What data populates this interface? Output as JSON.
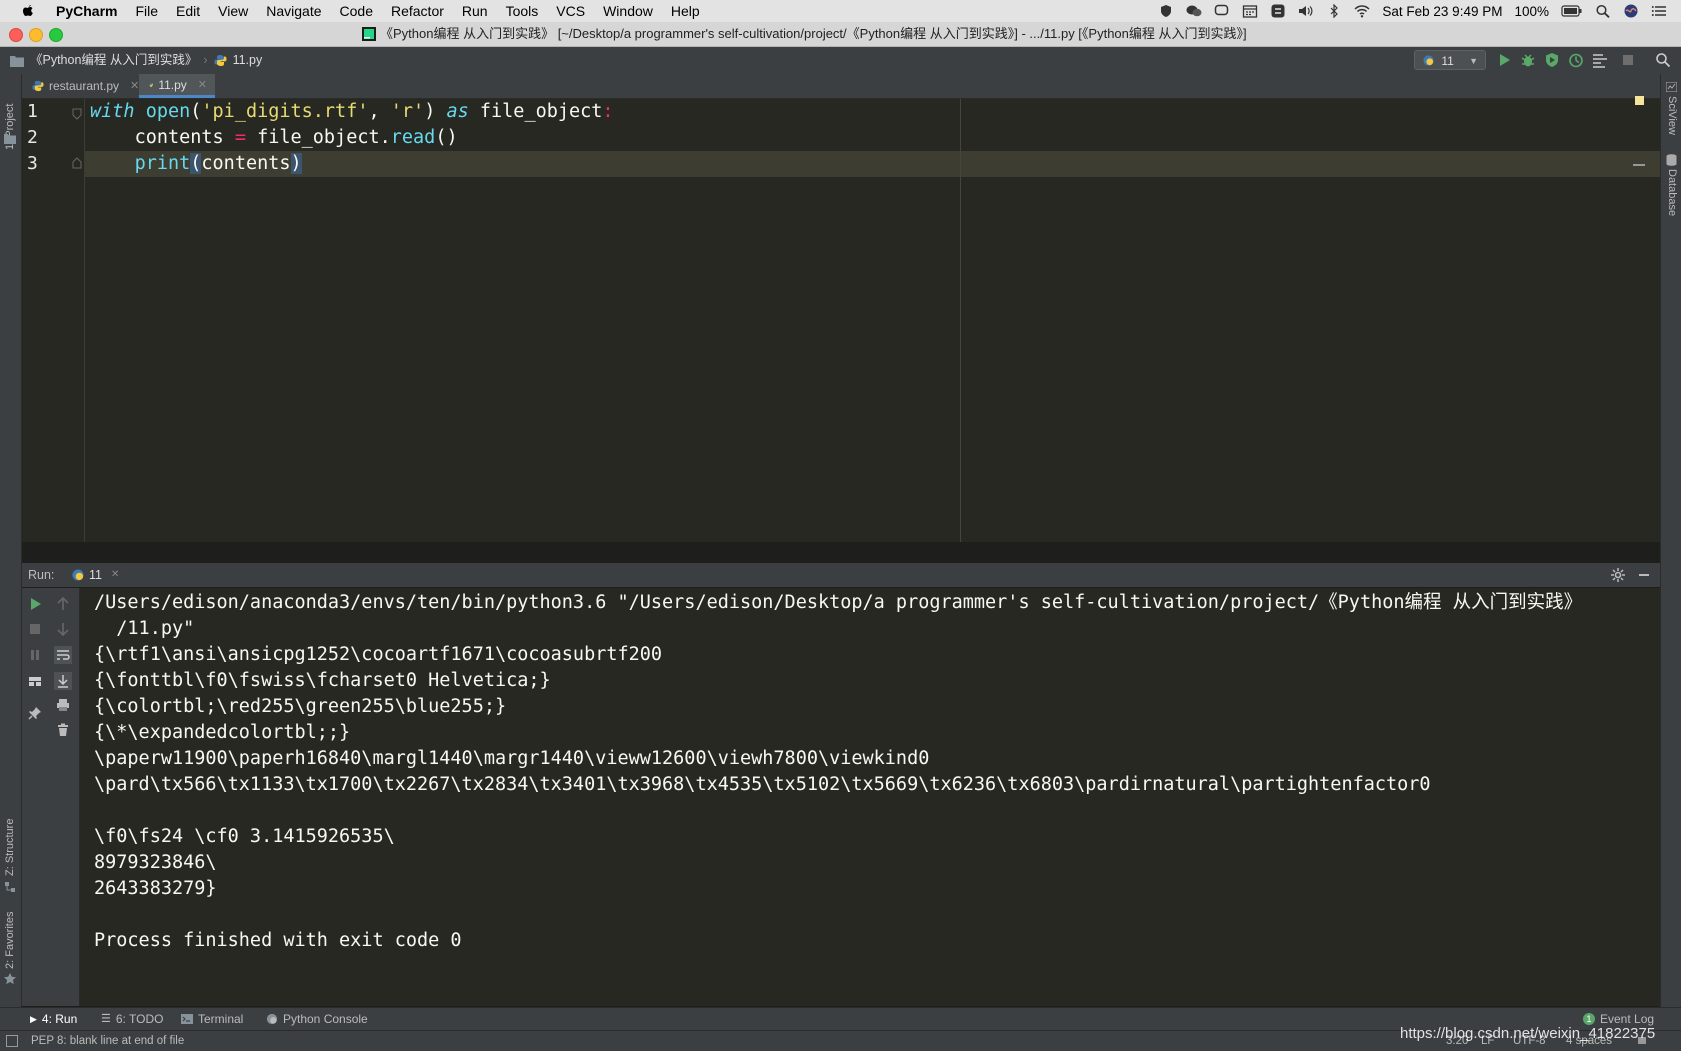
{
  "menubar": {
    "app": "PyCharm",
    "items": [
      "File",
      "Edit",
      "View",
      "Navigate",
      "Code",
      "Refactor",
      "Run",
      "Tools",
      "VCS",
      "Window",
      "Help"
    ],
    "clock": "Sat Feb 23  9:49 PM",
    "battery": "100%"
  },
  "titlebar": {
    "title": "《Python编程 从入门到实践》 [~/Desktop/a programmer's self-cultivation/project/《Python编程 从入门到实践》] - .../11.py [《Python编程 从入门到实践》]"
  },
  "navbar": {
    "project_crumb": "《Python编程 从入门到实践》",
    "file_crumb": "11.py",
    "run_config": "11"
  },
  "tabs": [
    {
      "label": "restaurant.py"
    },
    {
      "label": "11.py"
    }
  ],
  "side_labels": {
    "project": "1: Project",
    "structure": "Z: Structure",
    "favorites": "2: Favorites",
    "sciview": "SciView",
    "database": "Database"
  },
  "editor": {
    "line_numbers": [
      "1",
      "2",
      "3"
    ],
    "line1": {
      "kw_with": "with",
      "fn_open": "open",
      "p1": "(",
      "s1": "'pi_digits.rtf'",
      "comma": ", ",
      "s2": "'r'",
      "p2": ") ",
      "kw_as": "as",
      "var": " file_object",
      "colon": ":"
    },
    "line2": {
      "indent": "    ",
      "var": "contents ",
      "eq": "=",
      "rest1": " file_object.",
      "fn_read": "read",
      "rest2": "()"
    },
    "line3": {
      "indent": "    ",
      "fn_print": "print",
      "p1": "(",
      "arg": "contents",
      "p2": ")"
    }
  },
  "run_panel": {
    "label": "Run:",
    "tab": "11",
    "output": [
      "/Users/edison/anaconda3/envs/ten/bin/python3.6 \"/Users/edison/Desktop/a programmer's self-cultivation/project/《Python编程 从入门到实践》",
      "  /11.py\"",
      "{\\rtf1\\ansi\\ansicpg1252\\cocoartf1671\\cocoasubrtf200",
      "{\\fonttbl\\f0\\fswiss\\fcharset0 Helvetica;}",
      "{\\colortbl;\\red255\\green255\\blue255;}",
      "{\\*\\expandedcolortbl;;}",
      "\\paperw11900\\paperh16840\\margl1440\\margr1440\\vieww12600\\viewh7800\\viewkind0",
      "\\pard\\tx566\\tx1133\\tx1700\\tx2267\\tx2834\\tx3401\\tx3968\\tx4535\\tx5102\\tx5669\\tx6236\\tx6803\\pardirnatural\\partightenfactor0",
      "",
      "\\f0\\fs24 \\cf0 3.1415926535\\",
      "8979323846\\",
      "2643383279}",
      "",
      "Process finished with exit code 0"
    ]
  },
  "bottom_tabs": [
    {
      "label": "4: Run"
    },
    {
      "label": "6: TODO"
    },
    {
      "label": "Terminal"
    },
    {
      "label": "Python Console"
    }
  ],
  "event_log": {
    "count": "1",
    "label": "Event Log"
  },
  "status": {
    "message": "PEP 8: blank line at end of file",
    "position": "3:20",
    "line_sep": "LF",
    "encoding": "UTF-8",
    "indent": "4 spaces",
    "watermark": "https://blog.csdn.net/weixin_41822375"
  },
  "colors": {
    "accent": "#4a88c7",
    "run_green": "#59a869",
    "editor_bg": "#272822",
    "keyword": "#66d9ef",
    "string": "#e6db74",
    "operator": "#f92672"
  }
}
